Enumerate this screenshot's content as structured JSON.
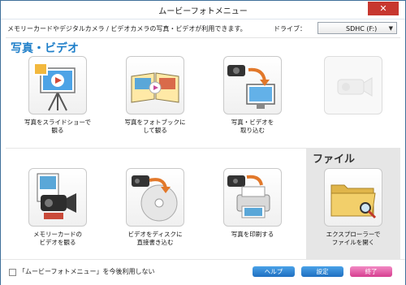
{
  "window": {
    "title": "ムービーフォトメニュー",
    "close_glyph": "✕"
  },
  "info": {
    "description": "メモリーカードやデジタルカメラ / ビデオカメラの写真・ビデオが利用できます。",
    "drive_label": "ドライブ：",
    "drive_value": "SDHC (F:)",
    "drive_arrow": "▼"
  },
  "section": {
    "title": "写真・ビデオ"
  },
  "panel": {
    "title": "ファイル"
  },
  "items": [
    {
      "label_line1": "写真をスライドショーで",
      "label_line2": "観る"
    },
    {
      "label_line1": "写真をフォトブックに",
      "label_line2": "して観る"
    },
    {
      "label_line1": "写真・ビデオを",
      "label_line2": "取り込む"
    },
    {
      "label_line1": "",
      "label_line2": ""
    },
    {
      "label_line1": "メモリーカードの",
      "label_line2": "ビデオを観る"
    },
    {
      "label_line1": "ビデオをディスクに",
      "label_line2": "直接書き込む"
    },
    {
      "label_line1": "写真を印刷する",
      "label_line2": ""
    },
    {
      "label_line1": "エクスプローラーで",
      "label_line2": "ファイルを開く"
    }
  ],
  "footer": {
    "checkbox_label": "「ムービーフォトメニュー」を今後利用しない",
    "help": "ヘルプ",
    "settings": "設定",
    "exit": "終了"
  }
}
